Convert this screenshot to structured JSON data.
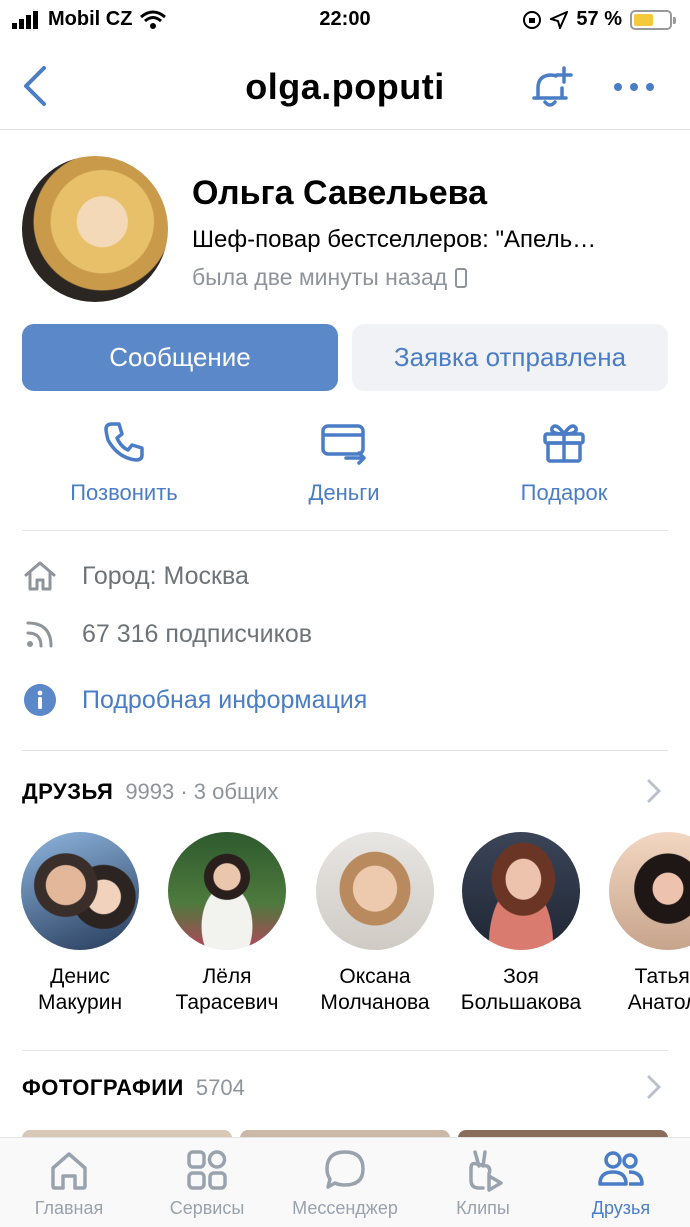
{
  "status_bar": {
    "carrier": "Mobil CZ",
    "time": "22:00",
    "battery": "57 %",
    "battery_level": 0.57
  },
  "nav": {
    "title": "olga.poputi"
  },
  "profile": {
    "name": "Ольга Савельева",
    "status": "Шеф-повар бестселлеров: \"Апель…",
    "last_seen": "была две минуты назад"
  },
  "buttons": {
    "message": "Сообщение",
    "request": "Заявка отправлена"
  },
  "actions": [
    {
      "label": "Позвонить",
      "icon": "phone-icon"
    },
    {
      "label": "Деньги",
      "icon": "money-transfer-icon"
    },
    {
      "label": "Подарок",
      "icon": "gift-icon"
    }
  ],
  "info": {
    "city": "Город: Москва",
    "followers": "67 316 подписчиков",
    "details_link": "Подробная информация"
  },
  "friends_section": {
    "title": "ДРУЗЬЯ",
    "count": "9993 · 3 общих",
    "items": [
      {
        "first": "Денис",
        "last": "Макурин"
      },
      {
        "first": "Лёля",
        "last": "Тарасевич"
      },
      {
        "first": "Оксана",
        "last": "Молчанова"
      },
      {
        "first": "Зоя",
        "last": "Большакова"
      },
      {
        "first": "Татьян",
        "last": "Анатоль"
      }
    ]
  },
  "photos_section": {
    "title": "ФОТОГРАФИИ",
    "count": "5704"
  },
  "tabbar": [
    {
      "label": "Главная",
      "icon": "home-icon"
    },
    {
      "label": "Сервисы",
      "icon": "services-icon"
    },
    {
      "label": "Мессенджер",
      "icon": "messenger-icon"
    },
    {
      "label": "Клипы",
      "icon": "clips-icon"
    },
    {
      "label": "Друзья",
      "icon": "friends-icon",
      "active": true
    }
  ],
  "colors": {
    "accent": "#4a7dc5",
    "primary_button": "#5b88c8",
    "secondary_button": "#f0f2f5",
    "muted": "#8f949b"
  }
}
